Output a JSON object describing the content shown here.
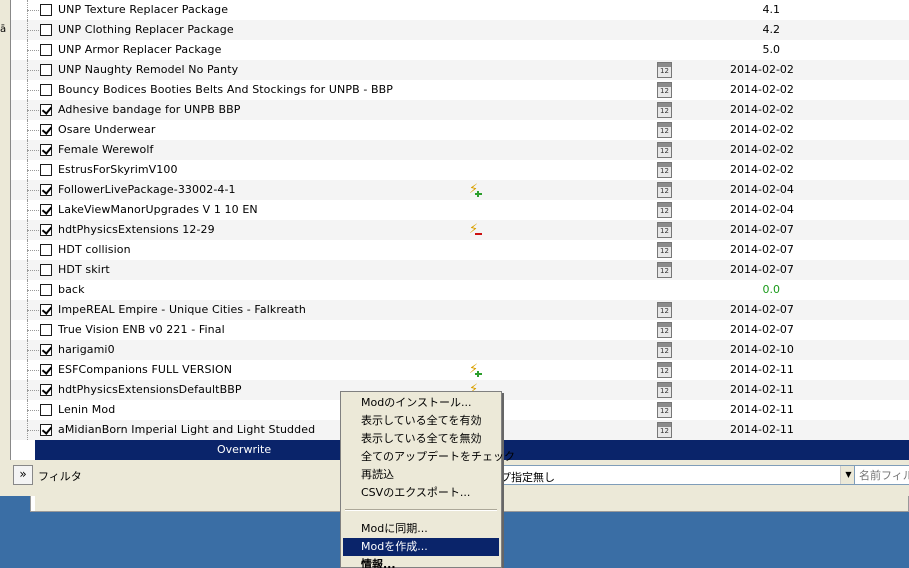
{
  "mod_list": {
    "rows": [
      {
        "name": "UNP Texture Replacer Package",
        "checked": false,
        "version": "4.1"
      },
      {
        "name": "UNP Clothing Replacer Package",
        "checked": false,
        "version": "4.2"
      },
      {
        "name": "UNP Armor Replacer Package",
        "checked": false,
        "version": "5.0"
      },
      {
        "name": "UNP Naughty Remodel No Panty",
        "checked": false,
        "date": "2014-02-02",
        "calendar": true
      },
      {
        "name": "Bouncy Bodices Booties Belts And Stockings for UNPB - BBP",
        "checked": false,
        "date": "2014-02-02",
        "calendar": true
      },
      {
        "name": "Adhesive bandage for UNPB BBP",
        "checked": true,
        "date": "2014-02-02",
        "calendar": true
      },
      {
        "name": "Osare Underwear",
        "checked": true,
        "date": "2014-02-02",
        "calendar": true
      },
      {
        "name": "Female Werewolf",
        "checked": true,
        "date": "2014-02-02",
        "calendar": true
      },
      {
        "name": "EstrusForSkyrimV100",
        "checked": false,
        "date": "2014-02-02",
        "calendar": true
      },
      {
        "name": "FollowerLivePackage-33002-4-1",
        "checked": true,
        "date": "2014-02-04",
        "calendar": true,
        "flag": "plus"
      },
      {
        "name": "LakeViewManorUpgrades V 1 10 EN",
        "checked": true,
        "date": "2014-02-04",
        "calendar": true
      },
      {
        "name": "hdtPhysicsExtensions 12-29",
        "checked": true,
        "date": "2014-02-07",
        "calendar": true,
        "flag": "minus"
      },
      {
        "name": "HDT collision",
        "checked": false,
        "date": "2014-02-07",
        "calendar": true
      },
      {
        "name": "HDT skirt",
        "checked": false,
        "date": "2014-02-07",
        "calendar": true
      },
      {
        "name": "back",
        "checked": false,
        "version": "0.0",
        "version_color": "#1a9a1a"
      },
      {
        "name": "ImpeREAL Empire - Unique Cities - Falkreath",
        "checked": true,
        "date": "2014-02-07",
        "calendar": true
      },
      {
        "name": "True Vision ENB v0 221 - Final",
        "checked": false,
        "date": "2014-02-07",
        "calendar": true
      },
      {
        "name": "harigami0",
        "checked": true,
        "date": "2014-02-10",
        "calendar": true
      },
      {
        "name": "ESFCompanions FULL VERSION",
        "checked": true,
        "date": "2014-02-11",
        "calendar": true,
        "flag": "plus"
      },
      {
        "name": "hdtPhysicsExtensionsDefaultBBP",
        "checked": true,
        "date": "2014-02-11",
        "calendar": true,
        "flag": "plus"
      },
      {
        "name": "Lenin Mod",
        "checked": false,
        "date": "2014-02-11",
        "calendar": true
      },
      {
        "name": "aMidianBorn Imperial Light and Light Studded",
        "checked": true,
        "date": "2014-02-11",
        "calendar": true
      }
    ],
    "overwrite_label": "Overwrite"
  },
  "filter_bar": {
    "expand_label": "»",
    "filter_label": "フィルタ",
    "category_value": "プ指定無し",
    "name_filter_placeholder": "名前フィルタ"
  },
  "context_menu": {
    "items": [
      {
        "label": "Modのインストール..."
      },
      {
        "label": "表示している全てを有効"
      },
      {
        "label": "表示している全てを無効"
      },
      {
        "label": "全てのアップデートをチェック"
      },
      {
        "label": "再読込"
      },
      {
        "label": "CSVのエクスポート..."
      },
      {
        "separator": true
      },
      {
        "label": "Modに同期..."
      },
      {
        "label": "Modを作成...",
        "selected": true
      },
      {
        "label": "情報...",
        "bold": true
      }
    ]
  },
  "edge_text": "ā",
  "colors": {
    "selection": "#0a246a",
    "desktop": "#3a6ea5",
    "version_green": "#1a9a1a"
  }
}
